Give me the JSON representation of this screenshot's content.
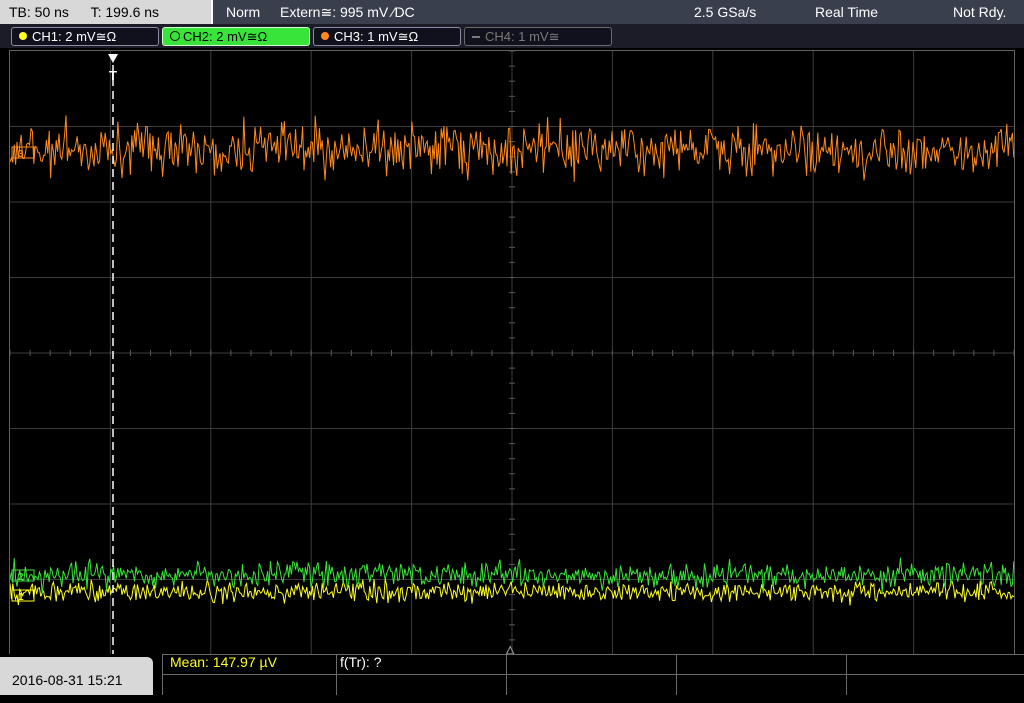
{
  "status": {
    "timebase": "TB: 50 ns",
    "trigger_time": "T: 199.6 ns",
    "trigger_mode": "Norm",
    "trigger_source": "Extern≅: 995 mV ⁄DC",
    "sample_rate": "2.5 GSa/s",
    "acq_mode": "Real Time",
    "run_state": "Not Rdy."
  },
  "channels": [
    {
      "label": "CH1: 2 mV≅Ω",
      "color": "#ffff20",
      "state": "on"
    },
    {
      "label": "CH2: 2 mV≅Ω",
      "color": "#39e43a",
      "state": "active"
    },
    {
      "label": "CH3: 1 mV≅Ω",
      "color": "#ff8a1e",
      "state": "on"
    },
    {
      "label": "CH4: 1 mV≅",
      "color": "#7a7a7a",
      "state": "off"
    }
  ],
  "screen": {
    "trigger_marker": "T",
    "ch3_marker": "3",
    "ch2_marker": "2",
    "ch1_marker": "1",
    "trigger_level_marker": "△"
  },
  "bottom": {
    "datetime": "2016-08-31 15:21",
    "mean": "Mean: 147.97 µV",
    "ftr": "f(Tr): ?"
  },
  "colors": {
    "ch1": "#ffff20",
    "ch2": "#39e43a",
    "ch3": "#ff8a1e",
    "grid": "#3c3c3c",
    "status_bar": "#3a3f4e"
  }
}
